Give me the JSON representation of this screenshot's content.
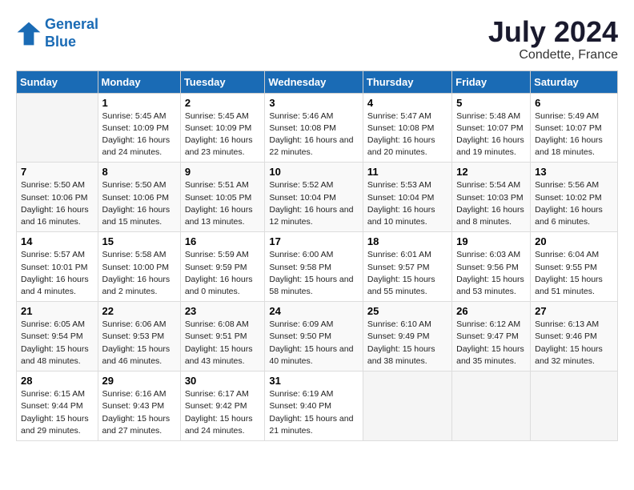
{
  "logo": {
    "line1": "General",
    "line2": "Blue"
  },
  "title": "July 2024",
  "subtitle": "Condette, France",
  "days": [
    "Sunday",
    "Monday",
    "Tuesday",
    "Wednesday",
    "Thursday",
    "Friday",
    "Saturday"
  ],
  "weeks": [
    [
      {
        "date": "",
        "info": ""
      },
      {
        "date": "1",
        "info": "Sunrise: 5:45 AM\nSunset: 10:09 PM\nDaylight: 16 hours\nand 24 minutes."
      },
      {
        "date": "2",
        "info": "Sunrise: 5:45 AM\nSunset: 10:09 PM\nDaylight: 16 hours\nand 23 minutes."
      },
      {
        "date": "3",
        "info": "Sunrise: 5:46 AM\nSunset: 10:08 PM\nDaylight: 16 hours\nand 22 minutes."
      },
      {
        "date": "4",
        "info": "Sunrise: 5:47 AM\nSunset: 10:08 PM\nDaylight: 16 hours\nand 20 minutes."
      },
      {
        "date": "5",
        "info": "Sunrise: 5:48 AM\nSunset: 10:07 PM\nDaylight: 16 hours\nand 19 minutes."
      },
      {
        "date": "6",
        "info": "Sunrise: 5:49 AM\nSunset: 10:07 PM\nDaylight: 16 hours\nand 18 minutes."
      }
    ],
    [
      {
        "date": "7",
        "info": "Sunrise: 5:50 AM\nSunset: 10:06 PM\nDaylight: 16 hours\nand 16 minutes."
      },
      {
        "date": "8",
        "info": "Sunrise: 5:50 AM\nSunset: 10:06 PM\nDaylight: 16 hours\nand 15 minutes."
      },
      {
        "date": "9",
        "info": "Sunrise: 5:51 AM\nSunset: 10:05 PM\nDaylight: 16 hours\nand 13 minutes."
      },
      {
        "date": "10",
        "info": "Sunrise: 5:52 AM\nSunset: 10:04 PM\nDaylight: 16 hours\nand 12 minutes."
      },
      {
        "date": "11",
        "info": "Sunrise: 5:53 AM\nSunset: 10:04 PM\nDaylight: 16 hours\nand 10 minutes."
      },
      {
        "date": "12",
        "info": "Sunrise: 5:54 AM\nSunset: 10:03 PM\nDaylight: 16 hours\nand 8 minutes."
      },
      {
        "date": "13",
        "info": "Sunrise: 5:56 AM\nSunset: 10:02 PM\nDaylight: 16 hours\nand 6 minutes."
      }
    ],
    [
      {
        "date": "14",
        "info": "Sunrise: 5:57 AM\nSunset: 10:01 PM\nDaylight: 16 hours\nand 4 minutes."
      },
      {
        "date": "15",
        "info": "Sunrise: 5:58 AM\nSunset: 10:00 PM\nDaylight: 16 hours\nand 2 minutes."
      },
      {
        "date": "16",
        "info": "Sunrise: 5:59 AM\nSunset: 9:59 PM\nDaylight: 16 hours\nand 0 minutes."
      },
      {
        "date": "17",
        "info": "Sunrise: 6:00 AM\nSunset: 9:58 PM\nDaylight: 15 hours\nand 58 minutes."
      },
      {
        "date": "18",
        "info": "Sunrise: 6:01 AM\nSunset: 9:57 PM\nDaylight: 15 hours\nand 55 minutes."
      },
      {
        "date": "19",
        "info": "Sunrise: 6:03 AM\nSunset: 9:56 PM\nDaylight: 15 hours\nand 53 minutes."
      },
      {
        "date": "20",
        "info": "Sunrise: 6:04 AM\nSunset: 9:55 PM\nDaylight: 15 hours\nand 51 minutes."
      }
    ],
    [
      {
        "date": "21",
        "info": "Sunrise: 6:05 AM\nSunset: 9:54 PM\nDaylight: 15 hours\nand 48 minutes."
      },
      {
        "date": "22",
        "info": "Sunrise: 6:06 AM\nSunset: 9:53 PM\nDaylight: 15 hours\nand 46 minutes."
      },
      {
        "date": "23",
        "info": "Sunrise: 6:08 AM\nSunset: 9:51 PM\nDaylight: 15 hours\nand 43 minutes."
      },
      {
        "date": "24",
        "info": "Sunrise: 6:09 AM\nSunset: 9:50 PM\nDaylight: 15 hours\nand 40 minutes."
      },
      {
        "date": "25",
        "info": "Sunrise: 6:10 AM\nSunset: 9:49 PM\nDaylight: 15 hours\nand 38 minutes."
      },
      {
        "date": "26",
        "info": "Sunrise: 6:12 AM\nSunset: 9:47 PM\nDaylight: 15 hours\nand 35 minutes."
      },
      {
        "date": "27",
        "info": "Sunrise: 6:13 AM\nSunset: 9:46 PM\nDaylight: 15 hours\nand 32 minutes."
      }
    ],
    [
      {
        "date": "28",
        "info": "Sunrise: 6:15 AM\nSunset: 9:44 PM\nDaylight: 15 hours\nand 29 minutes."
      },
      {
        "date": "29",
        "info": "Sunrise: 6:16 AM\nSunset: 9:43 PM\nDaylight: 15 hours\nand 27 minutes."
      },
      {
        "date": "30",
        "info": "Sunrise: 6:17 AM\nSunset: 9:42 PM\nDaylight: 15 hours\nand 24 minutes."
      },
      {
        "date": "31",
        "info": "Sunrise: 6:19 AM\nSunset: 9:40 PM\nDaylight: 15 hours\nand 21 minutes."
      },
      {
        "date": "",
        "info": ""
      },
      {
        "date": "",
        "info": ""
      },
      {
        "date": "",
        "info": ""
      }
    ]
  ]
}
